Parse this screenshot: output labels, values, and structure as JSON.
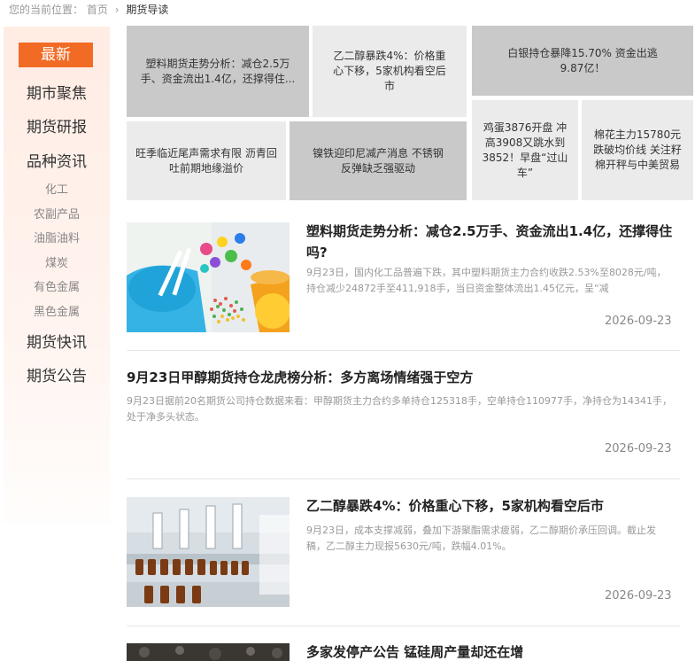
{
  "breadcrumb": {
    "prefix": "您的当前位置：",
    "home": "首页",
    "separator": "›",
    "current": "期货导读"
  },
  "sidebar": {
    "active": "最新",
    "main": [
      "期市聚焦",
      "期货研报",
      "品种资讯"
    ],
    "sub": [
      "化工",
      "农副产品",
      "油脂油料",
      "煤炭",
      "有色金属",
      "黑色金属"
    ],
    "bottom": [
      "期货快讯",
      "期货公告"
    ]
  },
  "tiles": [
    "塑料期货走势分析：减仓2.5万手、资金流出1.4亿，还撑得住...",
    "乙二醇暴跌4%：价格重心下移，5家机构看空后市",
    "白银持仓暴降15.70% 资金出逃9.87亿！",
    "旺季临近尾声需求有限 沥青回吐前期地缘溢价",
    "镍铁迎印尼减产消息 不锈钢反弹缺乏强驱动",
    "鸡蛋3876开盘 冲高3908又跳水到3852！早盘“过山车”",
    "棉花主力15780元跌破均价线 关注籽棉开秤与中美贸易"
  ],
  "articles": [
    {
      "title": "塑料期货走势分析：减仓2.5万手、资金流出1.4亿，还撑得住吗?",
      "summary": "9月23日，国内化工品普遍下跌，其中塑料期货主力合约收跌2.53%至8028元/吨，持仓减少24872手至411,918手，当日资金整体流出1.45亿元，呈“减",
      "date": "2026-09-23"
    },
    {
      "title": "9月23日甲醇期货持仓龙虎榜分析：多方离场情绪强于空方",
      "summary": "9月23日据前20名期货公司持仓数据来看：甲醇期货主力合约多单持仓125318手，空单持仓110977手，净持仓为14341手，处于净多头状态。",
      "date": "2026-09-23"
    },
    {
      "title": "乙二醇暴跌4%：价格重心下移，5家机构看空后市",
      "summary": "9月23日，成本支撑减弱，叠加下游聚酯需求疲弱，乙二醇期价承压回调。截止发稿，乙二醇主力现报5630元/吨，跌幅4.01%。",
      "date": "2026-09-23"
    },
    {
      "title": "多家发停产公告 锰硅周产量却还在增",
      "summary": "",
      "date": ""
    }
  ]
}
